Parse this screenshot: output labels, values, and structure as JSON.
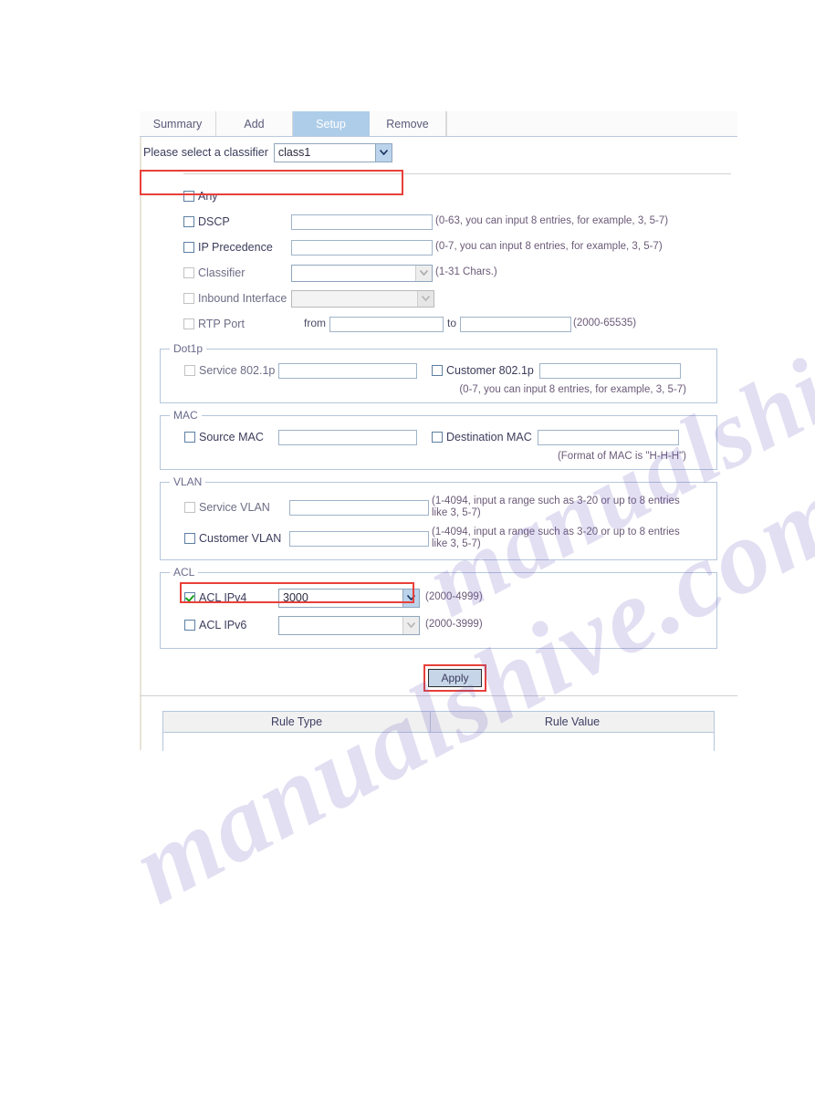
{
  "tabs": [
    {
      "label": "Summary",
      "active": false
    },
    {
      "label": "Add",
      "active": false
    },
    {
      "label": "Setup",
      "active": true
    },
    {
      "label": "Remove",
      "active": false
    }
  ],
  "classifier": {
    "label": "Please select a classifier",
    "selected": "class1"
  },
  "options": [
    {
      "name": "any",
      "label": "Any",
      "checked": false,
      "disabled": false,
      "field": "none",
      "hint": ""
    },
    {
      "name": "dscp",
      "label": "DSCP",
      "checked": false,
      "disabled": false,
      "field": "text",
      "value": "",
      "hint": "(0-63, you can input 8 entries, for example, 3, 5-7)"
    },
    {
      "name": "ip-precedence",
      "label": "IP Precedence",
      "checked": false,
      "disabled": false,
      "field": "text",
      "value": "",
      "hint": "(0-7, you can input 8 entries, for example, 3, 5-7)"
    },
    {
      "name": "classifier",
      "label": "Classifier",
      "checked": false,
      "disabled": true,
      "field": "select-half",
      "value": "",
      "hint": "(1-31 Chars.)"
    },
    {
      "name": "inbound-interface",
      "label": "Inbound Interface",
      "checked": false,
      "disabled": true,
      "field": "select-disabled",
      "value": "",
      "hint": ""
    },
    {
      "name": "rtp-port",
      "label": "RTP Port",
      "checked": false,
      "disabled": true,
      "field": "range",
      "from_label": "from",
      "to_label": "to",
      "from_value": "",
      "to_value": "",
      "hint": "(2000-65535)"
    }
  ],
  "dot1p": {
    "legend": "Dot1p",
    "left": {
      "label": "Service 802.1p",
      "checked": false,
      "disabled": true,
      "value": ""
    },
    "right": {
      "label": "Customer 802.1p",
      "checked": false,
      "disabled": false,
      "value": ""
    },
    "note": "(0-7, you can input 8 entries, for example, 3, 5-7)"
  },
  "mac": {
    "legend": "MAC",
    "left": {
      "label": "Source MAC",
      "checked": false,
      "disabled": false,
      "value": ""
    },
    "right": {
      "label": "Destination MAC",
      "checked": false,
      "disabled": false,
      "value": ""
    },
    "note": "(Format of MAC is \"H-H-H\")"
  },
  "vlan": {
    "legend": "VLAN",
    "rows": [
      {
        "label": "Service VLAN",
        "checked": false,
        "disabled": true,
        "value": "",
        "hint": "(1-4094, input a range such as 3-20 or up to 8 entries like 3, 5-7)"
      },
      {
        "label": "Customer VLAN",
        "checked": false,
        "disabled": false,
        "value": "",
        "hint": "(1-4094, input a range such as 3-20 or up to 8 entries like 3, 5-7)"
      }
    ]
  },
  "acl": {
    "legend": "ACL",
    "rows": [
      {
        "label": "ACL IPv4",
        "checked": true,
        "disabled": false,
        "value": "3000",
        "hint": "(2000-4999)",
        "highlighted": true
      },
      {
        "label": "ACL IPv6",
        "checked": false,
        "disabled": true,
        "value": "",
        "hint": "(2000-3999)",
        "highlighted": false
      }
    ]
  },
  "apply": {
    "label": "Apply"
  },
  "results": {
    "columns": [
      "Rule Type",
      "Rule Value"
    ],
    "rows": []
  },
  "watermark": {
    "line1": "manualshive.com",
    "line2": "manualshive.com"
  },
  "colors": {
    "tab_active_bg": "#aecde9",
    "annotation": "#e8403a",
    "check_green": "#19a11e",
    "fieldset_border": "#b5c6dc",
    "hint_text": "#6b5a78"
  }
}
